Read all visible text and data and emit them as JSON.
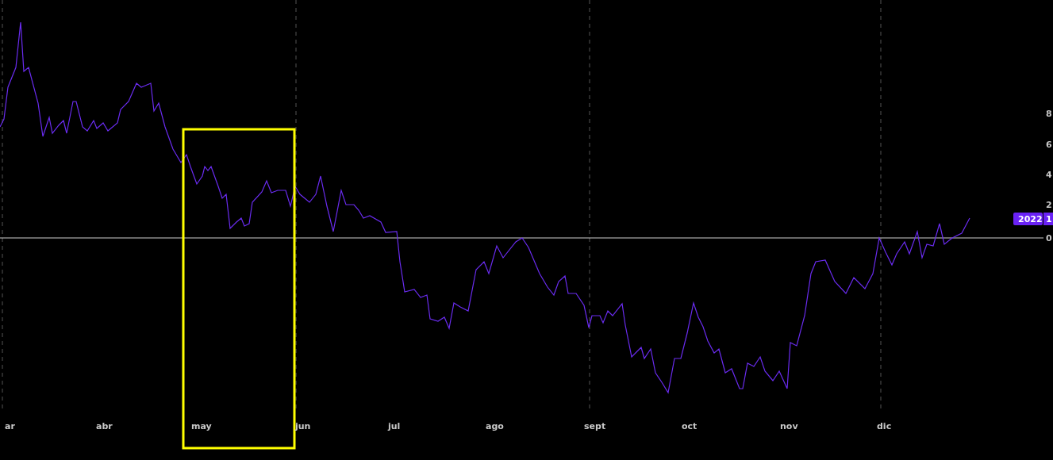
{
  "chart": {
    "x_labels": [
      "ar",
      "abr",
      "may",
      "jun",
      "jul",
      "ago",
      "sept",
      "oct",
      "nov",
      "dic"
    ],
    "y_labels": [
      "8",
      "6",
      "4",
      "2",
      "0"
    ],
    "series_tag": "2022",
    "value_tag": "1",
    "highlight_shown": true
  }
}
